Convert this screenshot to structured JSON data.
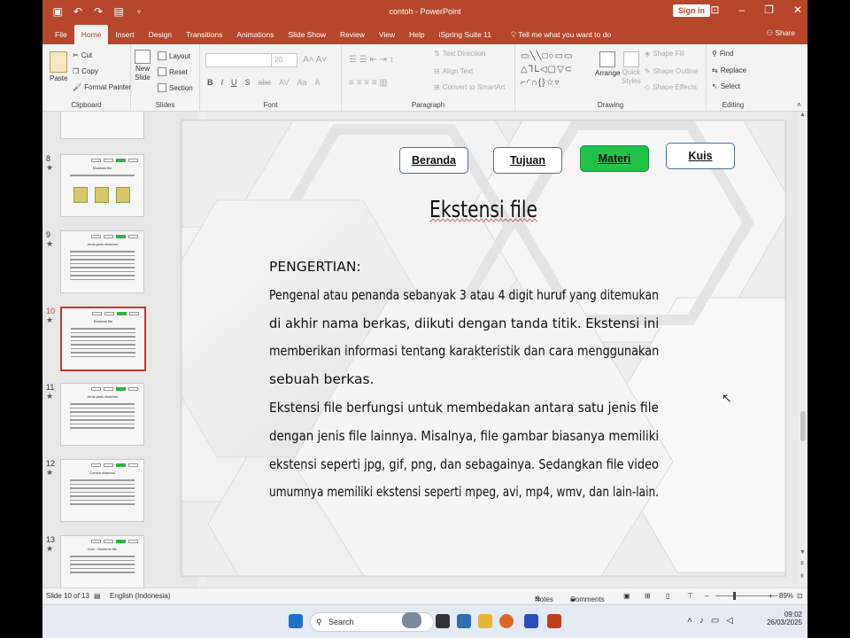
{
  "titlebar": {
    "title": "contoh - PowerPoint",
    "signin": "Sign in",
    "quick_access": [
      "save-icon",
      "undo-icon",
      "redo-icon",
      "slideshow-start-icon",
      "customize-icon"
    ]
  },
  "tabs": [
    {
      "label": "File"
    },
    {
      "label": "Home",
      "active": true
    },
    {
      "label": "Insert"
    },
    {
      "label": "Design"
    },
    {
      "label": "Transitions"
    },
    {
      "label": "Animations"
    },
    {
      "label": "Slide Show"
    },
    {
      "label": "Review"
    },
    {
      "label": "View"
    },
    {
      "label": "Help"
    },
    {
      "label": "iSpring Suite 11"
    }
  ],
  "tell_me": "Tell me what you want to do",
  "share": "Share",
  "ribbon": {
    "clipboard": {
      "label": "Clipboard",
      "paste": "Paste",
      "cut": "Cut",
      "copy": "Copy",
      "format_painter": "Format Painter"
    },
    "slides": {
      "label": "Slides",
      "new_slide": "New",
      "new_slide2": "Slide",
      "layout": "Layout",
      "reset": "Reset",
      "section": "Section"
    },
    "font": {
      "label": "Font",
      "size": "20"
    },
    "paragraph": {
      "label": "Paragraph",
      "text_direction": "Text Direction",
      "align_text": "Align Text",
      "smartart": "Convert to SmartArt"
    },
    "drawing": {
      "label": "Drawing",
      "arrange": "Arrange",
      "quick": "Quick",
      "styles": "Styles",
      "shape_fill": "Shape Fill",
      "shape_outline": "Shape Outline",
      "shape_effects": "Shape Effects"
    },
    "editing": {
      "label": "Editing",
      "find": "Find",
      "replace": "Replace",
      "select": "Select"
    }
  },
  "thumbnails": [
    {
      "num": "8",
      "title": "Ekstensi file"
    },
    {
      "num": "9",
      "title": "Jenis-jenis ekstensi"
    },
    {
      "num": "10",
      "title": "Ekstensi file",
      "selected": true
    },
    {
      "num": "11",
      "title": "Jenis-jenis ekstensi"
    },
    {
      "num": "12",
      "title": "Contoh ekstensi"
    },
    {
      "num": "13",
      "title": "Kuis : Ekstensi file"
    }
  ],
  "slide": {
    "nav": {
      "beranda": "Beranda",
      "tujuan": "Tujuan",
      "materi": "Materi",
      "kuis": "Kuis"
    },
    "title": "Ekstensi file",
    "lines": [
      "PENGERTIAN:",
      "Pengenal atau penanda sebanyak 3 atau 4 digit huruf yang ditemukan",
      "di akhir nama berkas, diikuti dengan tanda titik. Ekstensi ini",
      "memberikan informasi tentang karakteristik dan cara menggunakan",
      "sebuah berkas.",
      "Ekstensi file berfungsi untuk membedakan antara satu jenis file",
      "dengan jenis file lainnya. Misalnya, file gambar biasanya memiliki",
      "ekstensi seperti jpg, gif, png, dan sebagainya. Sedangkan file video",
      "umumnya memiliki ekstensi seperti mpeg, avi, mp4, wmv, dan lain-lain."
    ]
  },
  "status": {
    "slide_of": "Slide 10 of 13",
    "language": "English (Indonesia)",
    "notes": "Notes",
    "comments": "Comments",
    "zoom": "89%"
  },
  "taskbar": {
    "search": "Search",
    "time": "09:02",
    "date": "26/03/2025"
  },
  "colors": {
    "accent": "#b7472a",
    "materi_green": "#22c24a"
  }
}
